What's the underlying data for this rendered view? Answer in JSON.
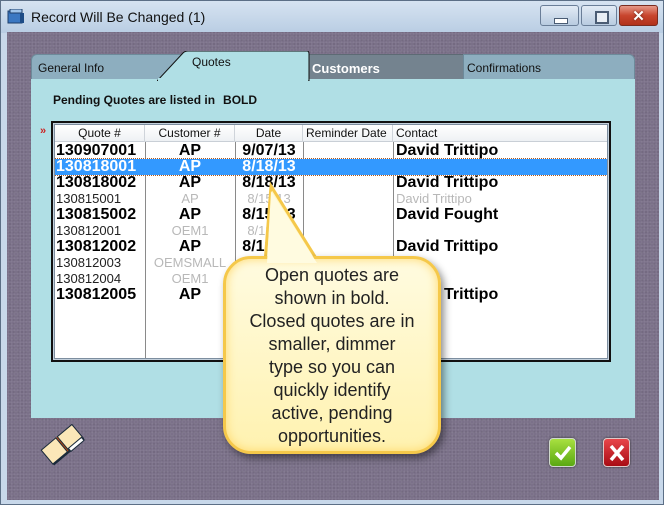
{
  "window": {
    "title": "Record Will Be Changed  (1)",
    "controls": {
      "minimize": "minimize",
      "maximize": "maximize",
      "close": "✕"
    }
  },
  "tabs": [
    {
      "label": "General Info",
      "active": false
    },
    {
      "label": "Quotes",
      "active": true
    },
    {
      "label": "Customers",
      "active": false,
      "highlighted": true
    },
    {
      "label": "Confirmations",
      "active": false
    }
  ],
  "quotes": {
    "pending_label": "Pending Quotes are listed in",
    "pending_emphasis": "BOLD",
    "row_pointer": "»",
    "columns": [
      "Quote #",
      "Customer #",
      "Date",
      "Reminder Date",
      "Contact"
    ],
    "rows": [
      {
        "quote": "130907001",
        "customer": "AP",
        "date": "9/07/13",
        "reminder": "",
        "contact": "David Trittipo",
        "status": "open",
        "selected": false
      },
      {
        "quote": "130818001",
        "customer": "AP",
        "date": "8/18/13",
        "reminder": "",
        "contact": "",
        "status": "open",
        "selected": true
      },
      {
        "quote": "130818002",
        "customer": "AP",
        "date": "8/18/13",
        "reminder": "",
        "contact": "David Trittipo",
        "status": "open",
        "selected": false
      },
      {
        "quote": "130815001",
        "customer": "AP",
        "date": "8/15/13",
        "reminder": "",
        "contact": "David Trittipo",
        "status": "closed",
        "selected": false
      },
      {
        "quote": "130815002",
        "customer": "AP",
        "date": "8/15/13",
        "reminder": "",
        "contact": "David Fought",
        "status": "open",
        "selected": false
      },
      {
        "quote": "130812001",
        "customer": "OEM1",
        "date": "8/12/13",
        "reminder": "",
        "contact": "",
        "status": "closed",
        "selected": false
      },
      {
        "quote": "130812002",
        "customer": "AP",
        "date": "8/12/13",
        "reminder": "",
        "contact": "David Trittipo",
        "status": "open",
        "selected": false
      },
      {
        "quote": "130812003",
        "customer": "OEMSMALL",
        "date": "",
        "reminder": "",
        "contact": "",
        "status": "closed",
        "selected": false
      },
      {
        "quote": "130812004",
        "customer": "OEM1",
        "date": "",
        "reminder": "",
        "contact": "",
        "status": "closed",
        "selected": false
      },
      {
        "quote": "130812005",
        "customer": "AP",
        "date": "",
        "reminder": "",
        "contact": "David Trittipo",
        "status": "open",
        "selected": false
      }
    ]
  },
  "callout": {
    "lines": [
      "Open quotes are",
      "shown in bold.",
      "Closed quotes are in",
      "smaller, dimmer",
      "type so you can",
      "quickly identify",
      "active, pending",
      "opportunities."
    ]
  },
  "footer": {
    "book_icon": "open-book",
    "ok_icon": "checkmark",
    "cancel_icon": "x-mark"
  },
  "colors": {
    "panel": "#b0dfe5",
    "selection": "#3399ff",
    "callout_fill": "#fff5c0",
    "callout_border": "#f5c84a",
    "background": "#7b7189"
  }
}
